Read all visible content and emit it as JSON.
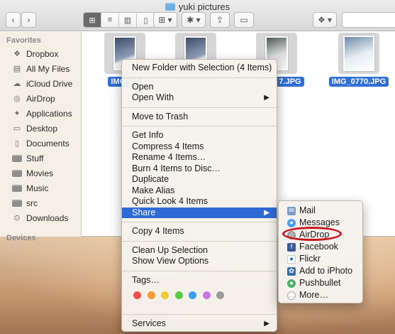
{
  "window": {
    "title": "yuki pictures"
  },
  "toolbar": {
    "back_icon": "chevron-left-icon",
    "forward_icon": "chevron-right-icon"
  },
  "sidebar": {
    "favorites_heading": "Favorites",
    "devices_heading": "Devices",
    "items": [
      {
        "label": "Dropbox",
        "icon": "dropbox-icon"
      },
      {
        "label": "All My Files",
        "icon": "all-files-icon"
      },
      {
        "label": "iCloud Drive",
        "icon": "cloud-icon"
      },
      {
        "label": "AirDrop",
        "icon": "airdrop-icon"
      },
      {
        "label": "Applications",
        "icon": "applications-icon"
      },
      {
        "label": "Desktop",
        "icon": "desktop-icon"
      },
      {
        "label": "Documents",
        "icon": "documents-icon"
      },
      {
        "label": "Stuff",
        "icon": "folder-icon"
      },
      {
        "label": "Movies",
        "icon": "movies-icon"
      },
      {
        "label": "Music",
        "icon": "music-icon"
      },
      {
        "label": "src",
        "icon": "folder-icon"
      },
      {
        "label": "Downloads",
        "icon": "downloads-icon"
      }
    ]
  },
  "files": [
    {
      "name": "IMG_07"
    },
    {
      "name": ""
    },
    {
      "name": "7.JPG"
    },
    {
      "name": "IMG_0770.JPG"
    }
  ],
  "context_menu": {
    "new_folder": "New Folder with Selection (4 Items)",
    "open": "Open",
    "open_with": "Open With",
    "move_to_trash": "Move to Trash",
    "get_info": "Get Info",
    "compress": "Compress 4 Items",
    "rename": "Rename 4 Items…",
    "burn": "Burn 4 Items to Disc…",
    "duplicate": "Duplicate",
    "make_alias": "Make Alias",
    "quick_look": "Quick Look 4 Items",
    "share": "Share",
    "copy": "Copy 4 Items",
    "clean_up": "Clean Up Selection",
    "show_view_options": "Show View Options",
    "tags": "Tags…",
    "services": "Services",
    "tag_colors": [
      "#f0524a",
      "#f59b32",
      "#f2cc2f",
      "#5cc948",
      "#3f9ef0",
      "#c578e0",
      "#9b9b9b"
    ]
  },
  "share_menu": {
    "items": [
      {
        "label": "Mail",
        "icon": "mail-icon"
      },
      {
        "label": "Messages",
        "icon": "messages-icon"
      },
      {
        "label": "AirDrop",
        "icon": "airdrop-icon"
      },
      {
        "label": "Facebook",
        "icon": "facebook-icon"
      },
      {
        "label": "Flickr",
        "icon": "flickr-icon"
      },
      {
        "label": "Add to iPhoto",
        "icon": "iphoto-icon"
      },
      {
        "label": "Pushbullet",
        "icon": "pushbullet-icon"
      },
      {
        "label": "More…",
        "icon": "more-icon"
      }
    ]
  }
}
